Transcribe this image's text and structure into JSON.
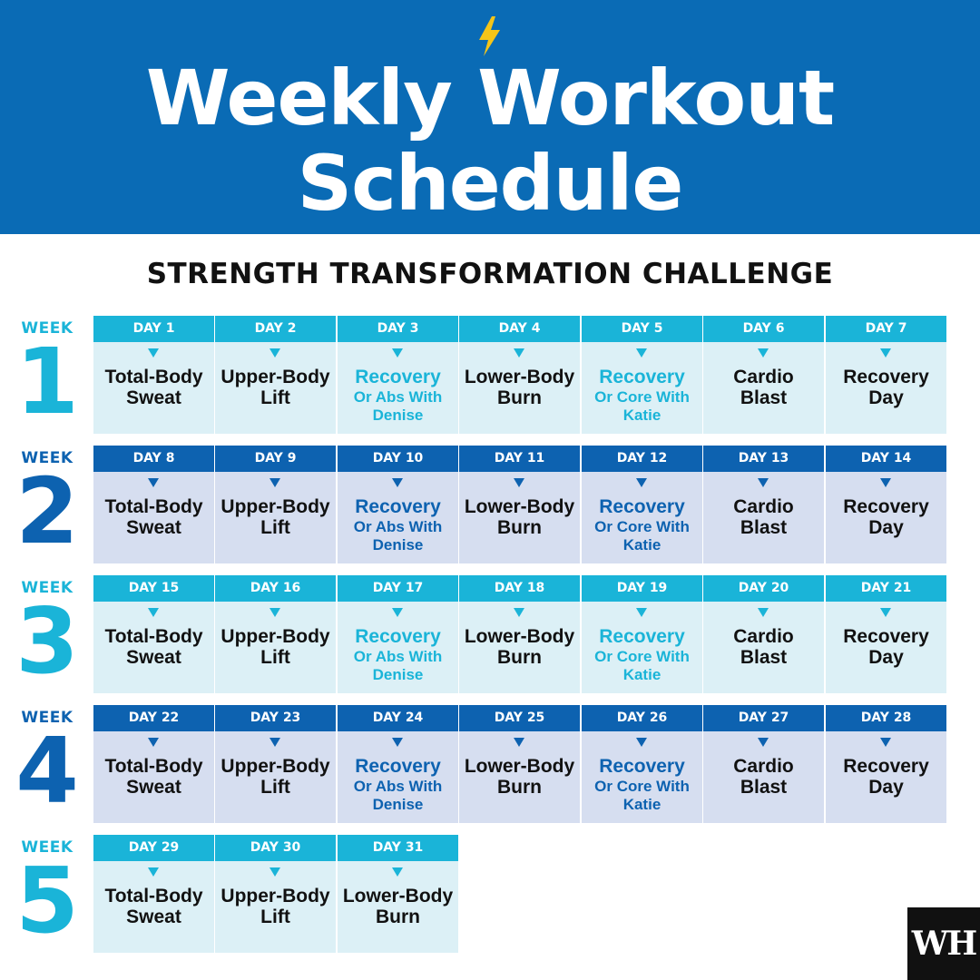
{
  "header": {
    "title_line1": "Weekly Workout",
    "title_line2": "Schedule",
    "subtitle": "STRENGTH TRANSFORMATION CHALLENGE",
    "icon": "lightning-bolt-icon"
  },
  "logo": {
    "text": "WH"
  },
  "colors": {
    "banner": "#0a6bb5",
    "bolt": "#f5c518",
    "light_head": "#1ab4d8",
    "light_body": "#dcf0f6",
    "dark_head": "#0d62b0",
    "dark_body": "#d6def0",
    "light_accent": "#1ab4d8",
    "dark_accent": "#0d62b0"
  },
  "weeks": [
    {
      "label": "WEEK",
      "number": "1",
      "theme": "light",
      "days": [
        {
          "day": "DAY 1",
          "name": "Total-Body Sweat",
          "sub": ""
        },
        {
          "day": "DAY 2",
          "name": "Upper-Body Lift",
          "sub": ""
        },
        {
          "day": "DAY 3",
          "name": "Recovery",
          "sub": "Or Abs With Denise"
        },
        {
          "day": "DAY 4",
          "name": "Lower-Body Burn",
          "sub": ""
        },
        {
          "day": "DAY 5",
          "name": "Recovery",
          "sub": "Or Core With Katie"
        },
        {
          "day": "DAY 6",
          "name": "Cardio Blast",
          "sub": ""
        },
        {
          "day": "DAY 7",
          "name": "Recovery Day",
          "sub": ""
        }
      ]
    },
    {
      "label": "WEEK",
      "number": "2",
      "theme": "dark",
      "days": [
        {
          "day": "DAY 8",
          "name": "Total-Body Sweat",
          "sub": ""
        },
        {
          "day": "DAY 9",
          "name": "Upper-Body Lift",
          "sub": ""
        },
        {
          "day": "DAY 10",
          "name": "Recovery",
          "sub": "Or Abs With Denise"
        },
        {
          "day": "DAY 11",
          "name": "Lower-Body Burn",
          "sub": ""
        },
        {
          "day": "DAY 12",
          "name": "Recovery",
          "sub": "Or Core With Katie"
        },
        {
          "day": "DAY 13",
          "name": "Cardio Blast",
          "sub": ""
        },
        {
          "day": "DAY 14",
          "name": "Recovery Day",
          "sub": ""
        }
      ]
    },
    {
      "label": "WEEK",
      "number": "3",
      "theme": "light",
      "days": [
        {
          "day": "DAY 15",
          "name": "Total-Body Sweat",
          "sub": ""
        },
        {
          "day": "DAY 16",
          "name": "Upper-Body Lift",
          "sub": ""
        },
        {
          "day": "DAY 17",
          "name": "Recovery",
          "sub": "Or Abs With Denise"
        },
        {
          "day": "DAY 18",
          "name": "Lower-Body Burn",
          "sub": ""
        },
        {
          "day": "DAY 19",
          "name": "Recovery",
          "sub": "Or Core With Katie"
        },
        {
          "day": "DAY 20",
          "name": "Cardio Blast",
          "sub": ""
        },
        {
          "day": "DAY 21",
          "name": "Recovery Day",
          "sub": ""
        }
      ]
    },
    {
      "label": "WEEK",
      "number": "4",
      "theme": "dark",
      "days": [
        {
          "day": "DAY 22",
          "name": "Total-Body Sweat",
          "sub": ""
        },
        {
          "day": "DAY 23",
          "name": "Upper-Body Lift",
          "sub": ""
        },
        {
          "day": "DAY 24",
          "name": "Recovery",
          "sub": "Or Abs With Denise"
        },
        {
          "day": "DAY 25",
          "name": "Lower-Body Burn",
          "sub": ""
        },
        {
          "day": "DAY 26",
          "name": "Recovery",
          "sub": "Or Core With Katie"
        },
        {
          "day": "DAY 27",
          "name": "Cardio Blast",
          "sub": ""
        },
        {
          "day": "DAY 28",
          "name": "Recovery Day",
          "sub": ""
        }
      ]
    },
    {
      "label": "WEEK",
      "number": "5",
      "theme": "light",
      "days": [
        {
          "day": "DAY 29",
          "name": "Total-Body Sweat",
          "sub": ""
        },
        {
          "day": "DAY 30",
          "name": "Upper-Body Lift",
          "sub": ""
        },
        {
          "day": "DAY 31",
          "name": "Lower-Body Burn",
          "sub": ""
        }
      ]
    }
  ]
}
